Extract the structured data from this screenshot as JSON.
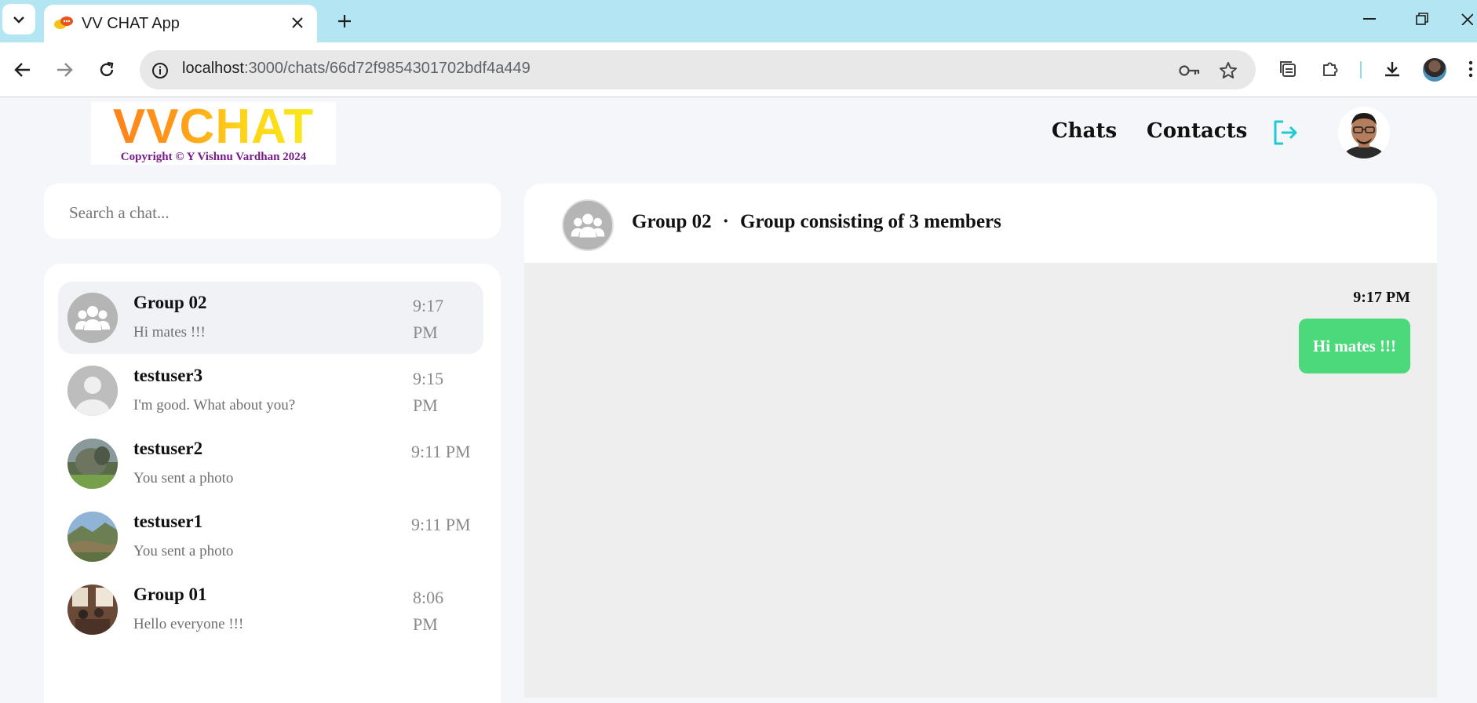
{
  "browser": {
    "tab_title": "VV CHAT App",
    "url_host": "localhost",
    "url_path": ":3000/chats/66d72f9854301702bdf4a449"
  },
  "header": {
    "logo_text": "VVCHAT",
    "logo_copyright": "Copyright © Y Vishnu Vardhan 2024",
    "nav": {
      "chats": "Chats",
      "contacts": "Contacts"
    },
    "accent_color": "#1ecad3"
  },
  "search": {
    "placeholder": "Search a chat..."
  },
  "chats": [
    {
      "name": "Group 02",
      "preview": "Hi mates !!!",
      "time": "9:17 PM",
      "avatar": "group-icon",
      "active": true
    },
    {
      "name": "testuser3",
      "preview": "I'm good. What about you?",
      "time": "9:15 PM",
      "avatar": "default-user-icon",
      "active": false
    },
    {
      "name": "testuser2",
      "preview": "You sent a photo",
      "time": "9:11 PM",
      "avatar": "photo",
      "active": false
    },
    {
      "name": "testuser1",
      "preview": "You sent a photo",
      "time": "9:11 PM",
      "avatar": "photo",
      "active": false
    },
    {
      "name": "Group 01",
      "preview": "Hello everyone !!!",
      "time": "8:06 PM",
      "avatar": "photo",
      "active": false
    }
  ],
  "conversation": {
    "title": "Group 02",
    "separator": "·",
    "subtitle": "Group consisting of 3 members",
    "messages": [
      {
        "time": "9:17 PM",
        "text": "Hi mates !!!",
        "outgoing": true,
        "bubble_color": "#4cd97b"
      }
    ]
  }
}
